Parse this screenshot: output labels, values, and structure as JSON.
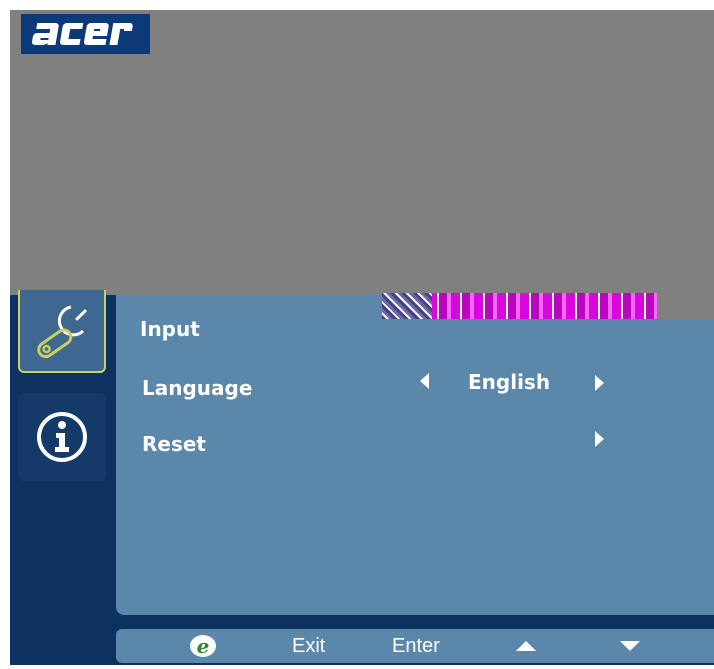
{
  "brand": {
    "logo_text": "acer",
    "logo_color": "#0c3a78"
  },
  "sidebar": {
    "items": [
      {
        "name": "settings",
        "icon": "wrench-settings-icon",
        "selected": true
      },
      {
        "name": "information",
        "icon": "info-icon",
        "selected": false
      }
    ]
  },
  "menu": {
    "items": [
      {
        "label": "Input",
        "value": "",
        "has_right_arrow": true
      },
      {
        "label": "Language",
        "value": "English",
        "has_left_arrow": true,
        "has_right_arrow": true
      },
      {
        "label": "Reset",
        "value": "",
        "has_right_arrow": true
      }
    ]
  },
  "footer": {
    "exit_label": "Exit",
    "enter_label": "Enter",
    "e_key_icon": "acer-e-key-icon",
    "up_icon": "up-arrow-icon",
    "down_icon": "down-arrow-icon"
  },
  "colors": {
    "panel": "#5b87ab",
    "background": "#0d3260",
    "selected_border": "#c9cf63",
    "gray_band": "#808080"
  }
}
